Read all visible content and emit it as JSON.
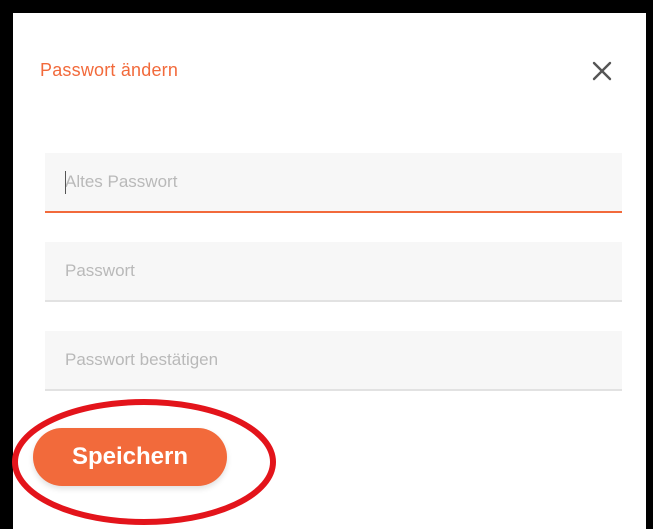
{
  "dialog": {
    "title": "Passwort ändern",
    "close_icon": "close-icon"
  },
  "form": {
    "old_password": {
      "placeholder": "Altes Passwort",
      "value": ""
    },
    "new_password": {
      "placeholder": "Passwort",
      "value": ""
    },
    "confirm_password": {
      "placeholder": "Passwort bestätigen",
      "value": ""
    }
  },
  "actions": {
    "save_label": "Speichern"
  },
  "colors": {
    "accent": "#f26a3b",
    "highlight": "#e3141b",
    "field_bg": "#f7f7f7"
  }
}
